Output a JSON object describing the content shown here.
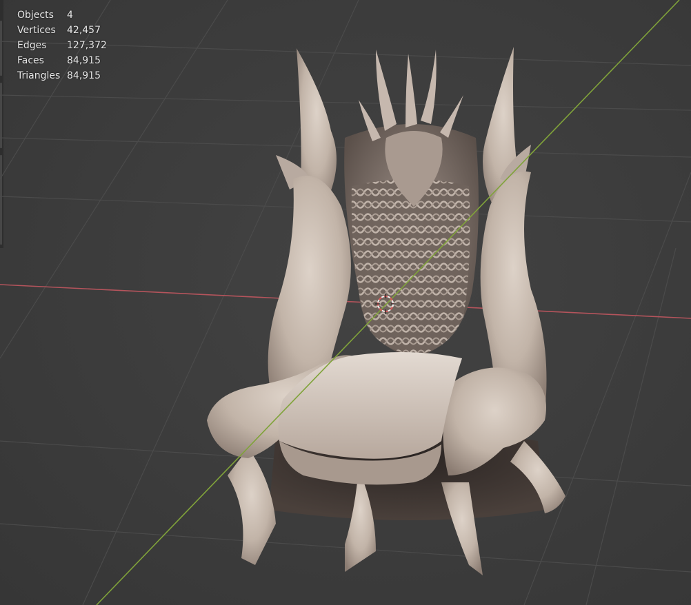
{
  "viewport": {
    "background": "#3d3d3d",
    "grid_color": "#4a4a4a",
    "x_axis_color": "#b5545c",
    "y_axis_color": "#80a33a",
    "cursor_colors": [
      "#d85a5a",
      "#f0f0f0"
    ]
  },
  "stats": {
    "objects_label": "Objects",
    "objects_value": "4",
    "vertices_label": "Vertices",
    "vertices_value": "42,457",
    "edges_label": "Edges",
    "edges_value": "127,372",
    "faces_label": "Faces",
    "faces_value": "84,915",
    "triangles_label": "Triangles",
    "triangles_value": "84,915"
  },
  "model": {
    "name": "throne-mesh",
    "base_color": "#cbbfb4",
    "shadow_color": "#6b5f58"
  }
}
